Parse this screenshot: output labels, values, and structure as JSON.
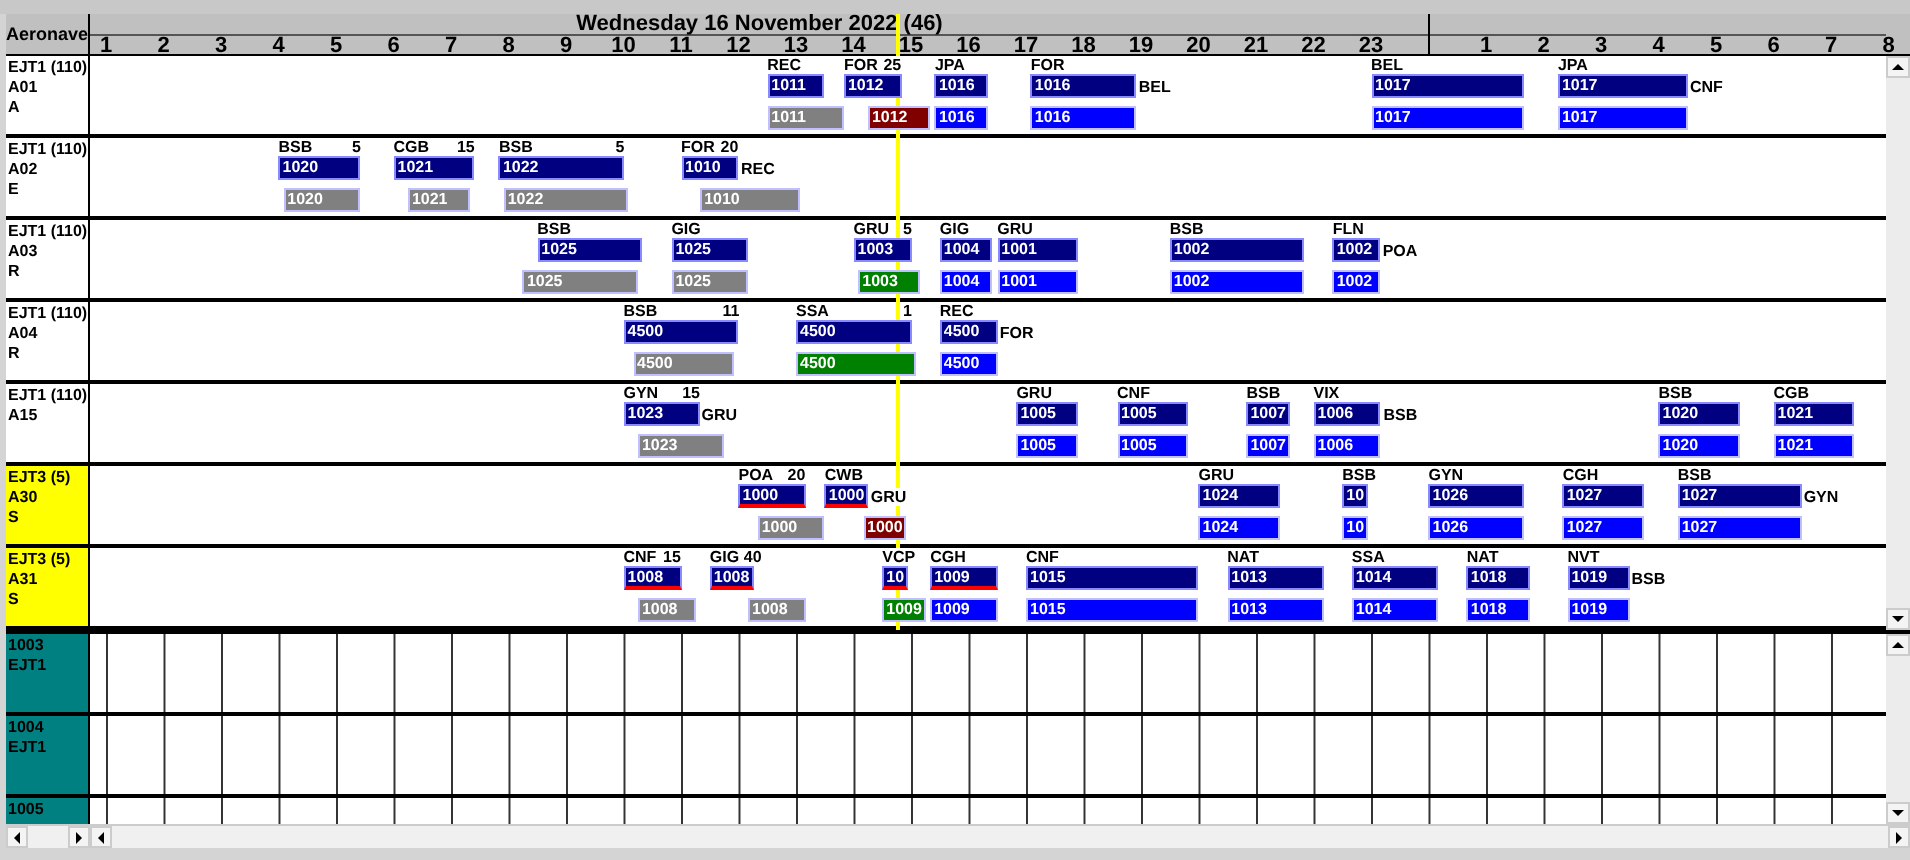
{
  "corner_label": "Aeronave",
  "timeline": {
    "days": [
      {
        "title": "Wednesday 16 November 2022 (46)",
        "hours": [
          "1",
          "2",
          "3",
          "4",
          "5",
          "6",
          "7",
          "8",
          "9",
          "10",
          "11",
          "12",
          "13",
          "14",
          "15",
          "16",
          "17",
          "18",
          "19",
          "20",
          "21",
          "22",
          "23"
        ]
      },
      {
        "hours": [
          "1",
          "2",
          "3",
          "4",
          "5",
          "6",
          "7",
          "8"
        ]
      }
    ]
  },
  "aircraft": [
    {
      "type": "EJT1 (110)",
      "registration": "A01",
      "code": "A",
      "color": "#ffffff",
      "flights": [
        {
          "origin": "REC",
          "number": "1011",
          "underlined": false
        },
        {
          "origin": "FOR",
          "note": "25",
          "number": "1012",
          "underlined": false
        },
        {
          "origin": "JPA",
          "number": "1016",
          "underlined": false
        },
        {
          "origin": "FOR",
          "number": "1016",
          "destination": "BEL",
          "underlined": false
        },
        {
          "origin": "BEL",
          "number": "1017",
          "underlined": false
        },
        {
          "origin": "JPA",
          "number": "1017",
          "destination": "CNF",
          "underlined": false
        }
      ],
      "actuals": [
        {
          "number": "1011",
          "color": "#808080"
        },
        {
          "number": "1012",
          "color": "#800000"
        },
        {
          "number": "1016",
          "color": "#0000ff"
        },
        {
          "number": "1016",
          "color": "#0000ff"
        },
        {
          "number": "1017",
          "color": "#0000ff"
        },
        {
          "number": "1017",
          "color": "#0000ff"
        }
      ]
    },
    {
      "type": "EJT1 (110)",
      "registration": "A02",
      "code": "E",
      "color": "#ffffff",
      "flights": [
        {
          "origin": "BSB",
          "note": "5",
          "number": "1020",
          "underlined": false
        },
        {
          "origin": "CGB",
          "note": "15",
          "number": "1021",
          "underlined": false
        },
        {
          "origin": "BSB",
          "note": "5",
          "number": "1022",
          "underlined": false
        },
        {
          "origin": "FOR",
          "note": "20",
          "number": "1010",
          "destination": "REC",
          "underlined": false
        }
      ],
      "actuals": [
        {
          "number": "1020",
          "color": "#808080"
        },
        {
          "number": "1021",
          "color": "#808080"
        },
        {
          "number": "1022",
          "color": "#808080"
        },
        {
          "number": "1010",
          "color": "#808080"
        }
      ]
    },
    {
      "type": "EJT1 (110)",
      "registration": "A03",
      "code": "R",
      "color": "#ffffff",
      "flights": [
        {
          "origin": "BSB",
          "number": "1025",
          "underlined": false
        },
        {
          "origin": "GIG",
          "number": "1025",
          "underlined": false
        },
        {
          "origin": "GRU",
          "note": "5",
          "number": "1003",
          "underlined": false
        },
        {
          "origin": "GIG",
          "number": "1004",
          "underlined": false
        },
        {
          "origin": "GRU",
          "number": "1001",
          "underlined": false
        },
        {
          "origin": "BSB",
          "number": "1002",
          "underlined": false
        },
        {
          "origin": "FLN",
          "number": "1002",
          "destination": "POA",
          "underlined": false
        }
      ],
      "actuals": [
        {
          "number": "1025",
          "color": "#808080"
        },
        {
          "number": "1025",
          "color": "#808080"
        },
        {
          "number": "1003",
          "color": "#008000"
        },
        {
          "number": "1004",
          "color": "#0000ff"
        },
        {
          "number": "1001",
          "color": "#0000ff"
        },
        {
          "number": "1002",
          "color": "#0000ff"
        },
        {
          "number": "1002",
          "color": "#0000ff"
        }
      ]
    },
    {
      "type": "EJT1 (110)",
      "registration": "A04",
      "code": "R",
      "color": "#ffffff",
      "flights": [
        {
          "origin": "BSB",
          "note": "11",
          "number": "4500",
          "underlined": false
        },
        {
          "origin": "SSA",
          "note": "1",
          "number": "4500",
          "underlined": false
        },
        {
          "origin": "REC",
          "number": "4500",
          "destination": "FOR",
          "underlined": false
        }
      ],
      "actuals": [
        {
          "number": "4500",
          "color": "#808080"
        },
        {
          "number": "4500",
          "color": "#008000"
        },
        {
          "number": "4500",
          "color": "#0000ff"
        }
      ]
    },
    {
      "type": "EJT1 (110)",
      "registration": "A15",
      "color": "#ffffff",
      "flights": [
        {
          "origin": "GYN",
          "note": "15",
          "number": "1023",
          "destination": "GRU",
          "underlined": false
        },
        {
          "origin": "GRU",
          "number": "1005",
          "underlined": false
        },
        {
          "origin": "CNF",
          "number": "1005",
          "underlined": false
        },
        {
          "origin": "BSB",
          "number": "1007",
          "underlined": false
        },
        {
          "origin": "VIX",
          "number": "1006",
          "destination": "BSB",
          "underlined": false
        },
        {
          "origin": "BSB",
          "number": "1020",
          "underlined": false
        },
        {
          "origin": "CGB",
          "number": "1021",
          "underlined": false
        }
      ],
      "actuals": [
        {
          "number": "1023",
          "color": "#808080"
        },
        {
          "number": "1005",
          "color": "#0000ff"
        },
        {
          "number": "1005",
          "color": "#0000ff"
        },
        {
          "number": "1007",
          "color": "#0000ff"
        },
        {
          "number": "1006",
          "color": "#0000ff"
        },
        {
          "number": "1020",
          "color": "#0000ff"
        },
        {
          "number": "1021",
          "color": "#0000ff"
        }
      ]
    },
    {
      "type": "EJT3 (5)",
      "registration": "A30",
      "code": "S",
      "color": "#ffff00",
      "flights": [
        {
          "origin": "POA",
          "note": "20",
          "number": "1000",
          "underlined": true
        },
        {
          "origin": "CWB",
          "number": "1000",
          "destination": "GRU",
          "underlined": true
        },
        {
          "origin": "GRU",
          "number": "1024",
          "underlined": false
        },
        {
          "origin": "BSB",
          "number": "10",
          "underlined": false
        },
        {
          "origin": "GYN",
          "number": "1026",
          "underlined": false
        },
        {
          "origin": "CGH",
          "number": "1027",
          "underlined": false
        },
        {
          "origin": "BSB",
          "number": "1027",
          "destination": "GYN",
          "underlined": false
        }
      ],
      "actuals": [
        {
          "number": "1000",
          "color": "#808080"
        },
        {
          "number": "1000",
          "color": "#800000"
        },
        {
          "number": "1024",
          "color": "#0000ff"
        },
        {
          "number": "10",
          "color": "#0000ff"
        },
        {
          "number": "1026",
          "color": "#0000ff"
        },
        {
          "number": "1027",
          "color": "#0000ff"
        },
        {
          "number": "1027",
          "color": "#0000ff"
        }
      ]
    },
    {
      "type": "EJT3 (5)",
      "registration": "A31",
      "code": "S",
      "color": "#ffff00",
      "flights": [
        {
          "origin": "CNF",
          "note": "15",
          "number": "1008",
          "underlined": true
        },
        {
          "origin": "GIG",
          "note": "40",
          "number": "1008",
          "underlined": true
        },
        {
          "origin": "VCP",
          "number": "10",
          "underlined": true
        },
        {
          "origin": "CGH",
          "number": "1009",
          "underlined": true
        },
        {
          "origin": "CNF",
          "number": "1015",
          "underlined": false
        },
        {
          "origin": "NAT",
          "number": "1013",
          "underlined": false
        },
        {
          "origin": "SSA",
          "number": "1014",
          "underlined": false
        },
        {
          "origin": "NAT",
          "number": "1018",
          "underlined": false
        },
        {
          "origin": "NVT",
          "number": "1019",
          "destination": "BSB",
          "underlined": false
        }
      ],
      "actuals": [
        {
          "number": "1008",
          "color": "#808080"
        },
        {
          "number": "1008",
          "color": "#808080"
        },
        {
          "number": "1009",
          "color": "#008000"
        },
        {
          "number": "1009",
          "color": "#0000ff"
        },
        {
          "number": "1015",
          "color": "#0000ff"
        },
        {
          "number": "1013",
          "color": "#0000ff"
        },
        {
          "number": "1014",
          "color": "#0000ff"
        },
        {
          "number": "1018",
          "color": "#0000ff"
        },
        {
          "number": "1019",
          "color": "#0000ff"
        }
      ]
    }
  ],
  "resources": [
    {
      "number": "1003",
      "type": "EJT1"
    },
    {
      "number": "1004",
      "type": "EJT1"
    },
    {
      "number": "1005"
    }
  ]
}
